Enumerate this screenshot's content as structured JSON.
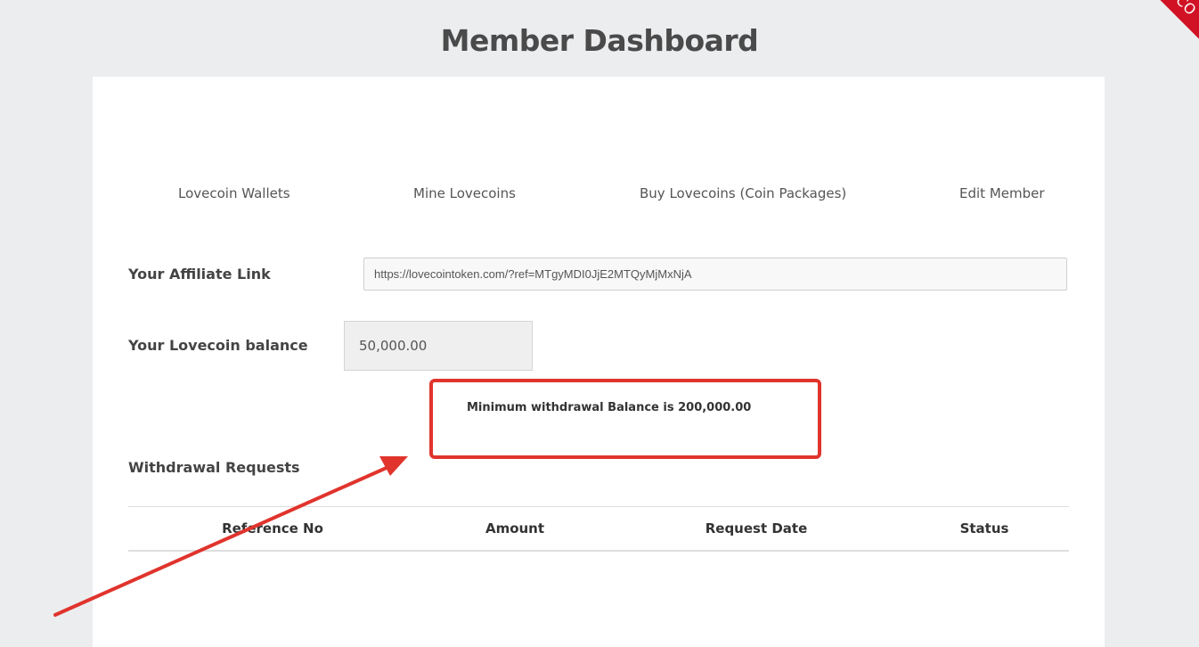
{
  "page": {
    "title": "Member Dashboard",
    "corner_ribbon_text": "CO"
  },
  "nav": {
    "items": [
      {
        "label": "Lovecoin Wallets"
      },
      {
        "label": "Mine Lovecoins"
      },
      {
        "label": "Buy Lovecoins (Coin Packages)"
      },
      {
        "label": "Edit Member"
      }
    ]
  },
  "affiliate": {
    "label": "Your Affiliate Link",
    "value": "https://lovecointoken.com/?ref=MTgyMDI0JjE2MTQyMjMxNjA"
  },
  "balance": {
    "label": "Your Lovecoin balance",
    "value": "50,000.00"
  },
  "notice": {
    "text": "Minimum withdrawal Balance is 200,000.00"
  },
  "withdrawals": {
    "title": "Withdrawal Requests",
    "columns": [
      "Reference No",
      "Amount",
      "Request Date",
      "Status"
    ]
  },
  "colors": {
    "annotation": "#e0342d",
    "ribbon": "#d11124",
    "background": "#ecedef"
  }
}
